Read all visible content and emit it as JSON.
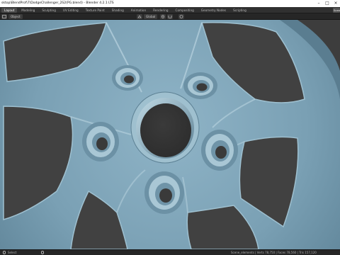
{
  "window": {
    "title": "sktop\\BlendProf\\7\\DodgeChallenger_2S2(PG.blend) - Blender 4.2.1 LTS"
  },
  "workspaces": {
    "tabs": [
      {
        "label": "Layout",
        "active": true
      },
      {
        "label": "Modeling",
        "active": false
      },
      {
        "label": "Sculpting",
        "active": false
      },
      {
        "label": "UV Editing",
        "active": false
      },
      {
        "label": "Texture Paint",
        "active": false
      },
      {
        "label": "Shading",
        "active": false
      },
      {
        "label": "Animation",
        "active": false
      },
      {
        "label": "Rendering",
        "active": false
      },
      {
        "label": "Compositing",
        "active": false
      },
      {
        "label": "Geometry Nodes",
        "active": false
      },
      {
        "label": "Scripting",
        "active": false
      }
    ],
    "scene_label": "Scene"
  },
  "header": {
    "object_label": "Object",
    "transform_orientation": "Global",
    "pivot_icon": "pivot-point-icon",
    "snap_icon": "snap-magnet-icon"
  },
  "viewport": {
    "object": "wheel rim (5-spoke alloy)",
    "colors": {
      "rim": "#7fa4b8",
      "rim_dark": "#4e6f82",
      "background": "#444444",
      "highlight": "#b9d3e0"
    }
  },
  "status": {
    "left_hint": "Select",
    "stats": "Scene_elements | Verts 78,750 | Faces 78,560 | Tris 157,120"
  },
  "colors": {
    "accent": "#4a4a4a",
    "titlebar": "#ffffff",
    "topbar": "#303030"
  }
}
